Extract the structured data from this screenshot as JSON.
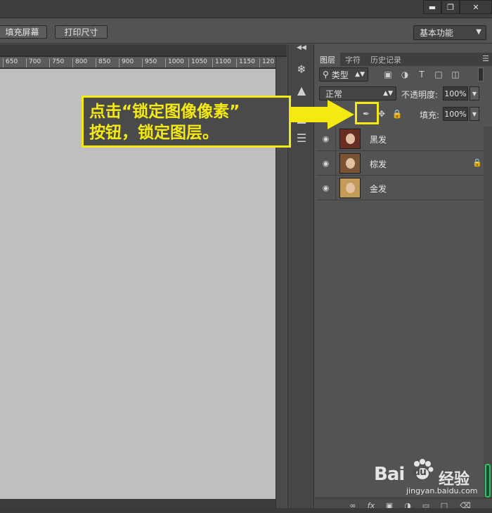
{
  "options_bar": {
    "fill_screen": "填充屏幕",
    "print_size": "打印尺寸",
    "workspace": "基本功能"
  },
  "ruler": {
    "ticks": [
      "650",
      "700",
      "750",
      "800",
      "850",
      "900",
      "950",
      "1000",
      "1050",
      "1100",
      "1150",
      "120"
    ]
  },
  "layers_panel": {
    "tabs": [
      "图层",
      "字符",
      "历史记录"
    ],
    "filter_kind": "类型",
    "blend_mode": "正常",
    "opacity_label": "不透明度:",
    "opacity_value": "100%",
    "fill_label": "填充:",
    "fill_value": "100%",
    "layers": [
      {
        "name": "黑发",
        "locked": false
      },
      {
        "name": "棕发",
        "locked": true
      },
      {
        "name": "金发",
        "locked": false
      }
    ]
  },
  "annotation": {
    "line1": "点击“锁定图像像素”",
    "line2": "按钮，锁定图层。",
    "color": "#f4ea12"
  },
  "watermark": {
    "brand": "Bai",
    "brand2": "du",
    "cn": "经验",
    "url": "jingyan.baidu.com"
  }
}
